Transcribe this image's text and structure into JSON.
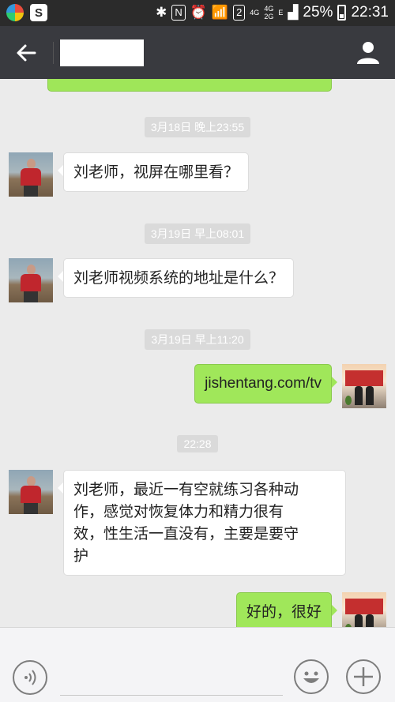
{
  "status_bar": {
    "network_labels": [
      "4G",
      "4G",
      "2G"
    ],
    "data_letter": "E",
    "sim_badge": "2",
    "battery": "25%",
    "time": "22:31"
  },
  "header": {
    "back_icon": "back-arrow-icon",
    "profile_icon": "user-icon"
  },
  "messages": [
    {
      "type": "time",
      "text": "3月18日 晚上23:55"
    },
    {
      "type": "in",
      "text": "刘老师，视屏在哪里看？"
    },
    {
      "type": "time",
      "text": "3月19日 早上08:01"
    },
    {
      "type": "in",
      "text": "刘老师视频系统的地址是什么？"
    },
    {
      "type": "time",
      "text": "3月19日 早上11:20"
    },
    {
      "type": "out",
      "text": "jishentang.com/tv"
    },
    {
      "type": "time",
      "text": "22:28"
    },
    {
      "type": "in",
      "lines": [
        "刘老师，最近一有空就练习各种动",
        "作，感觉对恢复体力和精力很有",
        "效，性生活一直没有，主要是要守",
        "护"
      ]
    },
    {
      "type": "out",
      "text": "好的，很好"
    }
  ],
  "input_bar": {
    "placeholder": "",
    "voice_icon": "voice-icon",
    "emoji_icon": "emoji-icon",
    "plus_icon": "plus-icon"
  },
  "colors": {
    "status_bar": "#2b2b2b",
    "title_bar": "#393a3f",
    "chat_bg": "#ebebeb",
    "out_bubble": "#a0e75a",
    "in_bubble": "#ffffff"
  }
}
